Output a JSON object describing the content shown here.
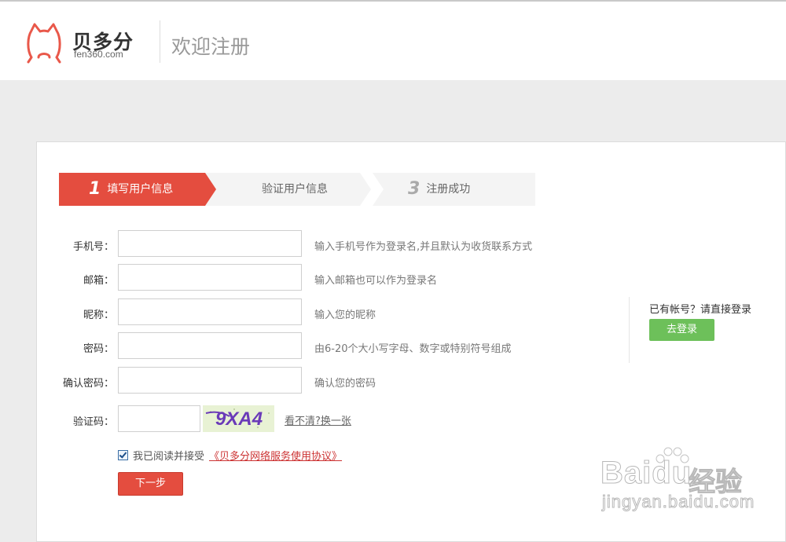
{
  "header": {
    "logo_text": "贝多分",
    "logo_domain": "fen360.com",
    "title": "欢迎注册"
  },
  "steps": [
    {
      "number": "1",
      "label": "填写用户信息",
      "active": true
    },
    {
      "number": "",
      "label": "验证用户信息",
      "active": false
    },
    {
      "number": "3",
      "label": "注册成功",
      "active": false
    }
  ],
  "form": {
    "fields": [
      {
        "label": "手机号：",
        "value": "",
        "hint": "输入手机号作为登录名,并且默认为收货联系方式"
      },
      {
        "label": "邮箱：",
        "value": "",
        "hint": "输入邮箱也可以作为登录名"
      },
      {
        "label": "昵称：",
        "value": "",
        "hint": "输入您的昵称"
      },
      {
        "label": "密码：",
        "value": "",
        "hint": "由6-20个大小写字母、数字或特别符号组成"
      },
      {
        "label": "确认密码：",
        "value": "",
        "hint": "确认您的密码"
      }
    ],
    "captcha": {
      "label": "验证码：",
      "value": "",
      "image_text": "9XA4",
      "refresh_link": "看不清?换一张"
    },
    "agreement": {
      "checked": true,
      "text": "我已阅读并接受",
      "link": "《贝多分网络服务使用协议》"
    },
    "next_button": "下一步"
  },
  "side": {
    "prompt": "已有帐号？请直接登录",
    "login_button": "去登录"
  },
  "watermark": {
    "brand": "Baidu",
    "product": "经验",
    "url": "jingyan.baidu.com"
  },
  "colors": {
    "accent_red": "#e44d3f",
    "login_green": "#6dc05a",
    "link_red": "#cc3333"
  }
}
